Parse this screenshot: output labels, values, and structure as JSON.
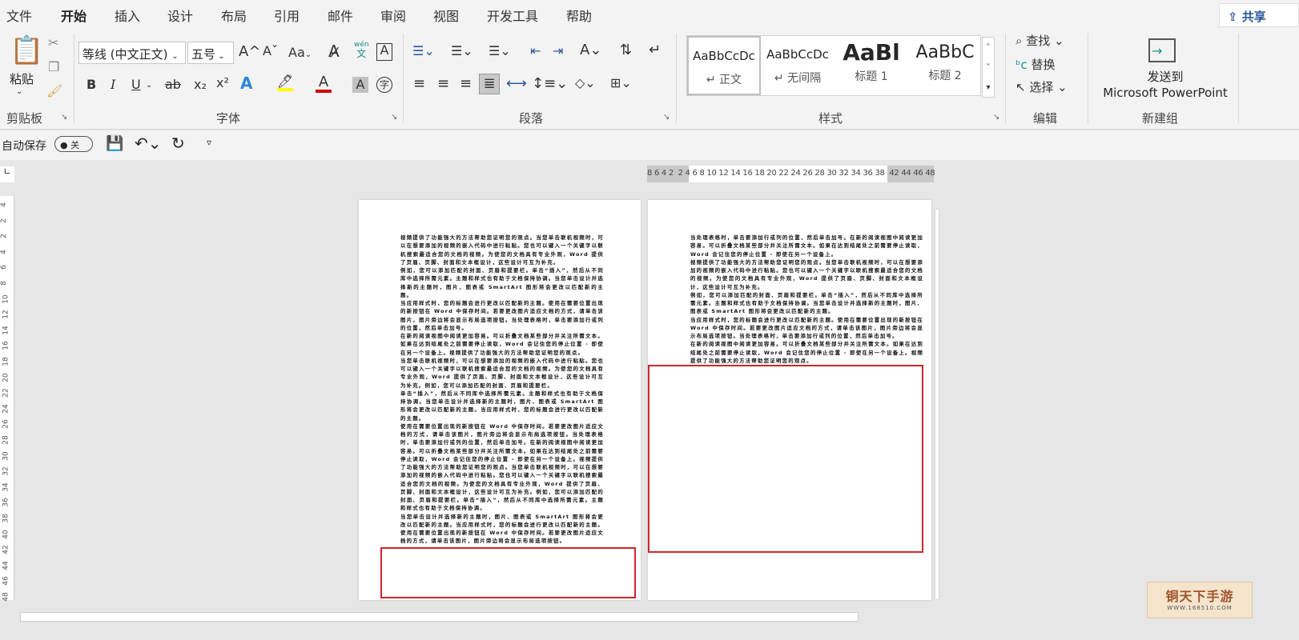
{
  "tabs": [
    "文件",
    "开始",
    "插入",
    "设计",
    "布局",
    "引用",
    "邮件",
    "审阅",
    "视图",
    "开发工具",
    "帮助"
  ],
  "active_tab": "开始",
  "share_label": "共享",
  "clipboard": {
    "paste": "粘贴",
    "label": "剪贴板"
  },
  "font": {
    "name": "等线 (中文正文)",
    "size": "五号",
    "label": "字体",
    "change_case": "Aa",
    "phonetic_top": "wén",
    "phonetic_bottom": "文",
    "bold": "B",
    "italic": "I",
    "underline": "U",
    "strike": "ab",
    "subscript": "x₂",
    "superscript": "x²",
    "text_effect": "A",
    "font_color": "A",
    "char_shading": "A",
    "enclose": "字",
    "grow": "A^",
    "shrink": "Aˇ",
    "highlight_color": "#ffff00",
    "font_color_value": "#d00000"
  },
  "paragraph": {
    "label": "段落"
  },
  "styles": {
    "label": "样式",
    "items": [
      {
        "preview": "AaBbCcDc",
        "name": "↵ 正文"
      },
      {
        "preview": "AaBbCcDc",
        "name": "↵ 无间隔"
      },
      {
        "preview": "AaBl",
        "name": "标题 1"
      },
      {
        "preview": "AaBbC",
        "name": "标题 2"
      }
    ]
  },
  "editing": {
    "label": "编辑",
    "find": "查找",
    "replace": "替换",
    "select": "选择"
  },
  "newgroup": {
    "label": "新建组",
    "send_line1": "发送到",
    "send_line2": "Microsoft PowerPoint"
  },
  "qat": {
    "autosave": "自动保存",
    "toggle": "关"
  },
  "hruler": "8 6 4 2  2 4 6 8 10 12 14 16 18 20 22 24 26 28 30 32 34 36 38  42 44 46 48",
  "vruler": [
    "4",
    "2",
    "2",
    "4",
    "6",
    "8",
    "10",
    "12",
    "14",
    "16",
    "18",
    "20",
    "22",
    "24",
    "26",
    "28",
    "30",
    "32",
    "34",
    "36",
    "38",
    "40",
    "42",
    "44",
    "46",
    "48"
  ],
  "page1": [
    "视频提供了功能强大的方法帮助您证明您的观点。当您单击联机视频时，可以在想要添加的视频的嵌入代码中进行粘贴。您也可以键入一个关键字以联机搜索最适合您的文档的视频。为使您的文档具有专业外观，Word 提供了页眉、页脚、封面和文本框设计，这些设计可互为补充。",
    "例如，您可以添加匹配的封面、页眉和提要栏。单击“插入”，然后从不同库中选择所需元素。主题和样式也有助于文档保持协调。当您单击设计并选择新的主题时，图片、图表或 SmartArt 图形将会更改以匹配新的主题。",
    "当应用样式时，您的标题会进行更改以匹配新的主题。使用在需要位置出现的新按钮在 Word 中保存时间。若要更改图片适应文档的方式，请单击该图片，图片旁边将会显示布局选项按钮。当处理表格时，单击要添加行或列的位置，然后单击加号。",
    "在新的阅读视图中阅读更加容易。可以折叠文档某些部分并关注所需文本。如果在达到结尾处之前需要停止读取，Word 会记住您的停止位置 - 即使在另一个设备上。视频提供了功能强大的方法帮助您证明您的观点。",
    "当您单击联机视频时，可以在想要添加的视频的嵌入代码中进行粘贴。您也可以键入一个关键字以联机搜索最适合您的文档的视频。为使您的文档具有专业外观，Word 提供了页眉、页脚、封面和文本框设计，这些设计可互为补充。例如，您可以添加匹配的封面、页眉和提要栏。",
    "单击“插入”，然后从不同库中选择所需元素。主题和样式也有助于文档保持协调。当您单击设计并选择新的主题时，图片、图表或 SmartArt 图形将会更改以匹配新的主题。当应用样式时，您的标题会进行更改以匹配新的主题。",
    "使用在需要位置出现的新按钮在 Word 中保存时间。若要更改图片适应文档的方式，请单击该图片，图片旁边将会显示布局选项按钮。当处理表格时，单击要添加行或列的位置，然后单击加号。在新的阅读视图中阅读更加容易。可以折叠文档某些部分并关注所需文本。如果在达到结尾处之前需要停止读取，Word 会记住您的停止位置 - 即使在另一个设备上。视频提供了功能强大的方法帮助您证明您的观点。当您单击联机视频时，可以在想要添加的视频的嵌入代码中进行粘贴。您也可以键入一个关键字以联机搜索最适合您的文档的视频。为使您的文档具有专业外观，Word 提供了页眉、页脚、封面和文本框设计，这些设计可互为补充。例如，您可以添加匹配的封面、页眉和提要栏。单击“插入”，然后从不同库中选择所需元素。主题和样式也有助于文档保持协调。",
    "当您单击设计并选择新的主题时，图片、图表或 SmartArt 图形将会更改以匹配新的主题。当应用样式时，您的标题会进行更改以匹配新的主题。使用在需要位置出现的新按钮在 Word 中保存时间。若要更改图片适应文档的方式，请单击该图片，图片旁边将会显示布局选项按钮。"
  ],
  "page2": [
    "当处理表格时，单击要添加行或列的位置，然后单击加号。在新的阅读视图中阅读更加容易。可以折叠文档某些部分并关注所需文本。如果在达到结尾处之前需要停止读取，Word 会记住您的停止位置 - 即使在另一个设备上。",
    "视频提供了功能强大的方法帮助您证明您的观点。当您单击联机视频时，可以在想要添加的视频的嵌入代码中进行粘贴。您也可以键入一个关键字以联机搜索最适合您的文档的视频。为使您的文档具有专业外观，Word 提供了页眉、页脚、封面和文本框设计，这些设计可互为补充。",
    "例如，您可以添加匹配的封面、页眉和提要栏。单击“插入”，然后从不同库中选择所需元素。主题和样式也有助于文档保持协调。当您单击设计并选择新的主题时，图片、图表或 SmartArt 图形将会更改以匹配新的主题。",
    "当应用样式时，您的标题会进行更改以匹配新的主题。使用在需要位置出现的新按钮在 Word 中保存时间。若要更改图片适应文档的方式，请单击该图片，图片旁边将会显示布局选项按钮。当处理表格时，单击要添加行或列的位置，然后单击加号。",
    "在新的阅读视图中阅读更加容易。可以折叠文档某些部分并关注所需文本。如果在达到结尾处之前需要停止读取，Word 会记住您的停止位置 - 即使在另一个设备上。视频提供了功能强大的方法帮助您证明您的观点。"
  ],
  "highlight_color": "#c8282d",
  "watermark": {
    "text": "铜天下手游",
    "url": "WWW.168510.COM"
  }
}
